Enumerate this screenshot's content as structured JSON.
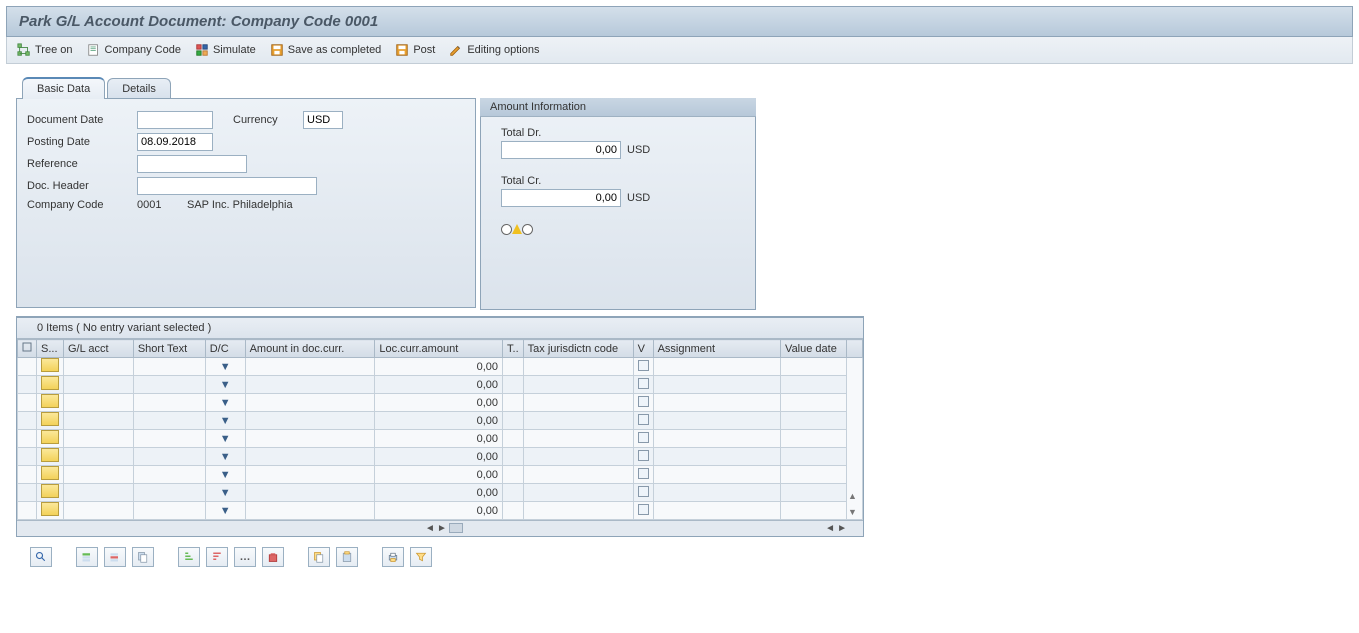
{
  "title": "Park G/L Account Document: Company Code 0001",
  "toolbar": {
    "tree_on": "Tree on",
    "company_code": "Company Code",
    "simulate": "Simulate",
    "save_completed": "Save as completed",
    "post": "Post",
    "editing_options": "Editing options"
  },
  "tabs": {
    "basic": "Basic Data",
    "details": "Details"
  },
  "basic": {
    "document_date_lbl": "Document Date",
    "document_date_val": "",
    "currency_lbl": "Currency",
    "currency_val": "USD",
    "posting_date_lbl": "Posting Date",
    "posting_date_val": "08.09.2018",
    "reference_lbl": "Reference",
    "reference_val": "",
    "doc_header_lbl": "Doc. Header",
    "doc_header_val": "",
    "company_code_lbl": "Company Code",
    "company_code_val": "0001",
    "company_name": "SAP Inc. Philadelphia"
  },
  "amount": {
    "panel_title": "Amount Information",
    "total_dr_lbl": "Total Dr.",
    "total_dr_val": "0,00",
    "total_cr_lbl": "Total Cr.",
    "total_cr_val": "0,00",
    "currency_dr": "USD",
    "currency_cr": "USD"
  },
  "table": {
    "header": "0 Items ( No entry variant selected )",
    "columns": {
      "sel": "",
      "status": "S...",
      "gl_acct": "G/L acct",
      "short_text": "Short Text",
      "dc": "D/C",
      "amount_doc": "Amount in doc.curr.",
      "loc_amount": "Loc.curr.amount",
      "t": "T..",
      "tax_jur": "Tax jurisdictn code",
      "v": "V",
      "assignment": "Assignment",
      "value_date": "Value date"
    },
    "rows": [
      {
        "loc_amount": "0,00"
      },
      {
        "loc_amount": "0,00"
      },
      {
        "loc_amount": "0,00"
      },
      {
        "loc_amount": "0,00"
      },
      {
        "loc_amount": "0,00"
      },
      {
        "loc_amount": "0,00"
      },
      {
        "loc_amount": "0,00"
      },
      {
        "loc_amount": "0,00"
      },
      {
        "loc_amount": "0,00"
      }
    ]
  }
}
